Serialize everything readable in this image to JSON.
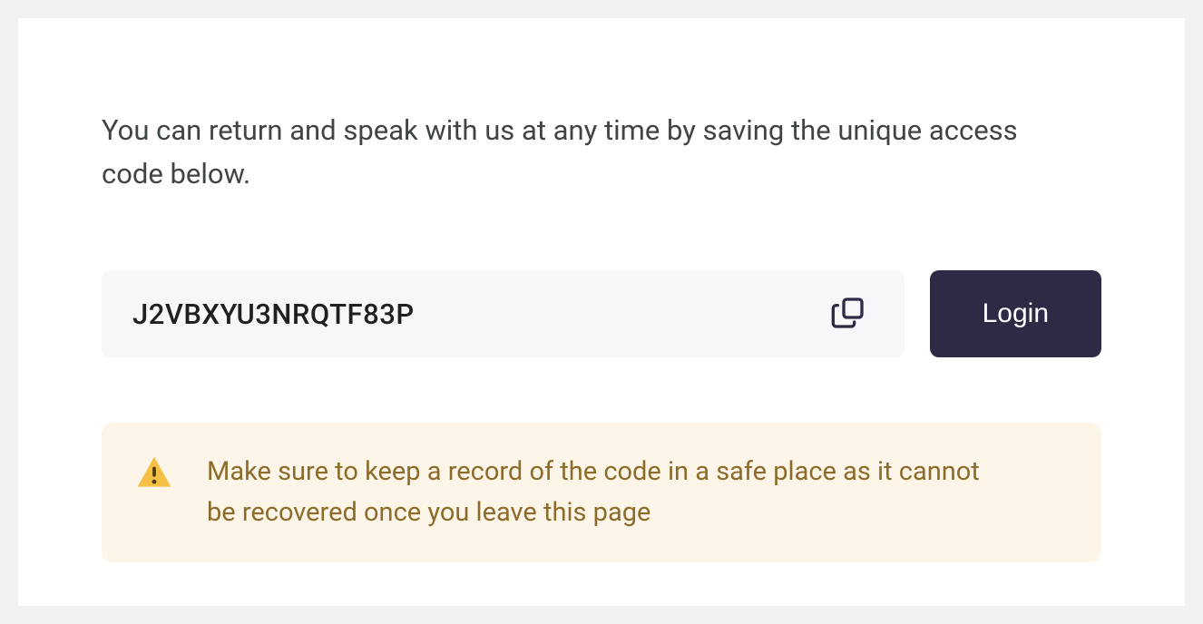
{
  "intro": "You can return and speak with us at any time by saving the unique access code below.",
  "access_code": "J2VBXYU3NRQTF83P",
  "login_label": "Login",
  "warning": "Make sure to keep a record of the code in a safe place as it cannot be recovered once you leave this page"
}
